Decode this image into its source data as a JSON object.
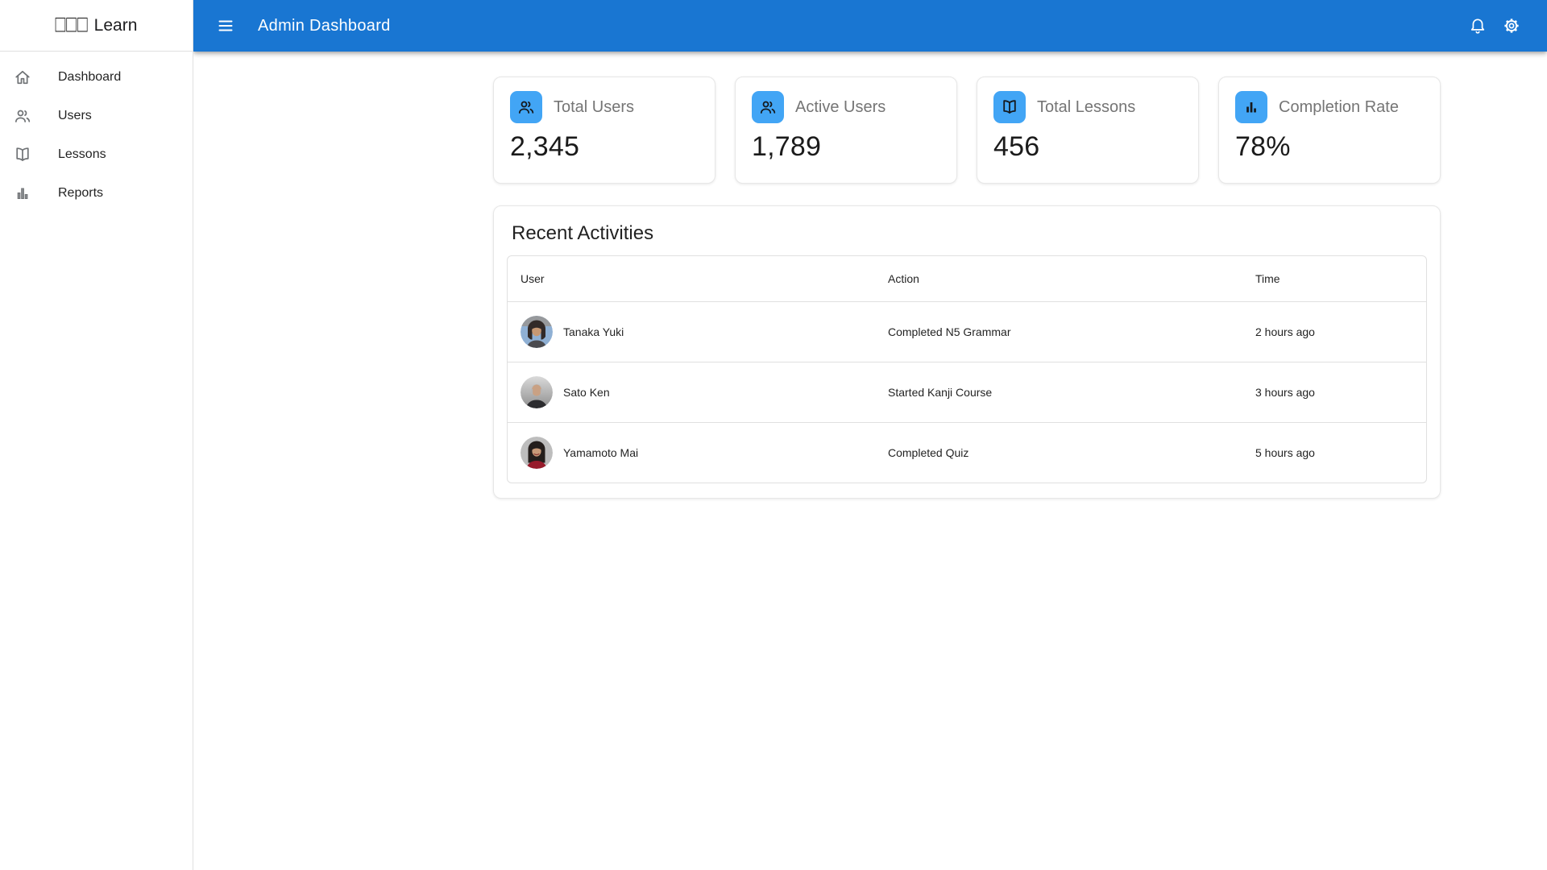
{
  "brand": {
    "missing_glyphs": "□□□",
    "label": "Learn"
  },
  "app": {
    "title": "Admin Dashboard"
  },
  "colors": {
    "appbar": "#1976d2",
    "stat_icon_bg": "#42a5f5",
    "border": "#e0e0e0",
    "muted_text": "#757575"
  },
  "sidebar": {
    "items": [
      {
        "label": "Dashboard",
        "icon": "home-icon"
      },
      {
        "label": "Users",
        "icon": "people-icon"
      },
      {
        "label": "Lessons",
        "icon": "book-icon"
      },
      {
        "label": "Reports",
        "icon": "bar-chart-icon"
      }
    ]
  },
  "stats": [
    {
      "label": "Total Users",
      "value": "2,345",
      "icon": "people-icon"
    },
    {
      "label": "Active Users",
      "value": "1,789",
      "icon": "people-icon"
    },
    {
      "label": "Total Lessons",
      "value": "456",
      "icon": "book-icon"
    },
    {
      "label": "Completion Rate",
      "value": "78%",
      "icon": "bar-chart-icon"
    }
  ],
  "recent_activities": {
    "title": "Recent Activities",
    "columns": [
      "User",
      "Action",
      "Time"
    ],
    "rows": [
      {
        "user": "Tanaka Yuki",
        "action": "Completed N5 Grammar",
        "time": "2 hours ago"
      },
      {
        "user": "Sato Ken",
        "action": "Started Kanji Course",
        "time": "3 hours ago"
      },
      {
        "user": "Yamamoto Mai",
        "action": "Completed Quiz",
        "time": "5 hours ago"
      }
    ]
  }
}
